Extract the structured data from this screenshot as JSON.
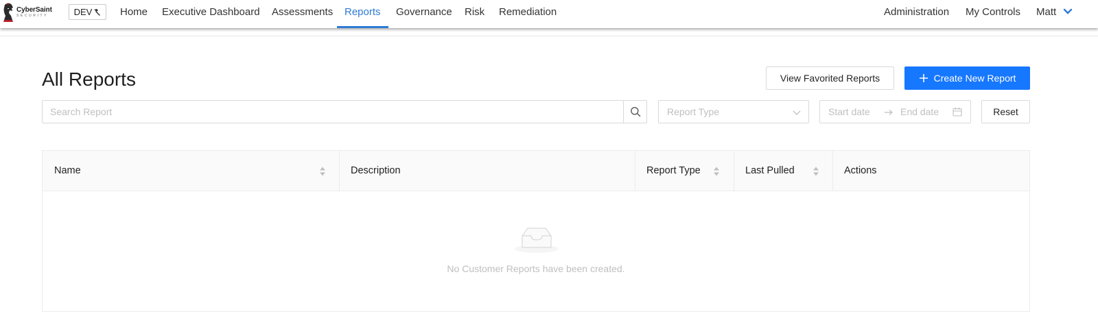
{
  "brand": {
    "name": "CyberSaint",
    "tagline": "SECURITY"
  },
  "env_badge": "DEV",
  "nav": {
    "items": [
      {
        "label": "Home",
        "active": false
      },
      {
        "label": "Executive Dashboard",
        "active": false
      },
      {
        "label": "Assessments",
        "active": false
      },
      {
        "label": "Reports",
        "active": true
      },
      {
        "label": "Governance",
        "active": false
      },
      {
        "label": "Risk",
        "active": false
      },
      {
        "label": "Remediation",
        "active": false
      }
    ],
    "right": [
      {
        "label": "Administration"
      },
      {
        "label": "My Controls"
      },
      {
        "label": "Matt"
      }
    ]
  },
  "page": {
    "title": "All Reports",
    "favorites_button": "View Favorited Reports",
    "create_button": "Create New Report",
    "reset_button": "Reset"
  },
  "filters": {
    "search_placeholder": "Search Report",
    "search_value": "",
    "report_type_placeholder": "Report Type",
    "start_date_placeholder": "Start date",
    "end_date_placeholder": "End date"
  },
  "table": {
    "columns": [
      {
        "label": "Name",
        "sortable": true
      },
      {
        "label": "Description",
        "sortable": false
      },
      {
        "label": "Report Type",
        "sortable": true
      },
      {
        "label": "Last Pulled",
        "sortable": true
      },
      {
        "label": "Actions",
        "sortable": false
      }
    ],
    "rows": [],
    "empty_text": "No Customer Reports have been created."
  },
  "colors": {
    "primary": "#1677ff",
    "active_nav": "#2e7bd6",
    "brand_red": "#b3202a"
  },
  "icons": [
    "knight-logo-icon",
    "hammer-icon",
    "chevron-down-icon",
    "plus-icon",
    "search-icon",
    "arrow-right-icon",
    "calendar-icon",
    "sort-icon",
    "empty-inbox-icon"
  ]
}
